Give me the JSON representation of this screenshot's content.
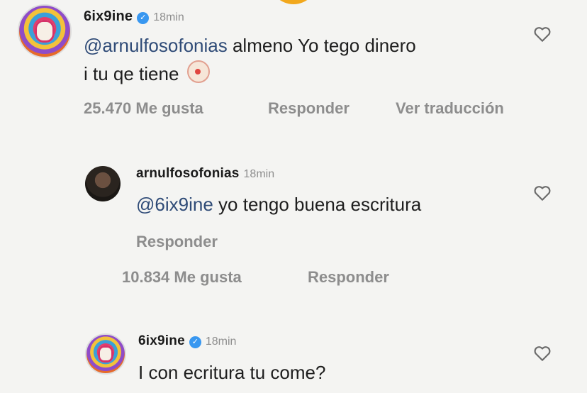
{
  "comment1": {
    "username": "6ix9ine",
    "time": "18min",
    "mention": "@arnulfosofonias",
    "text_line1": "almeno Yo tego dinero",
    "text_line2": "i tu qe tiene",
    "emoji": "clown-face",
    "likes": "25.470 Me gusta",
    "reply_label": "Responder",
    "translate_label": "Ver traducción"
  },
  "reply1": {
    "username": "arnulfosofonias",
    "time": "18min",
    "mention": "@6ix9ine",
    "text": "yo tengo buena escritura",
    "reply_label": "Responder",
    "likes": "10.834 Me gusta",
    "reply_label2": "Responder"
  },
  "reply2": {
    "username": "6ix9ine",
    "time": "18min",
    "text": "I con ecritura tu come?"
  },
  "colors": {
    "mention": "#2f4b77",
    "verified": "#3897f0",
    "meta": "#8d8d8d"
  }
}
